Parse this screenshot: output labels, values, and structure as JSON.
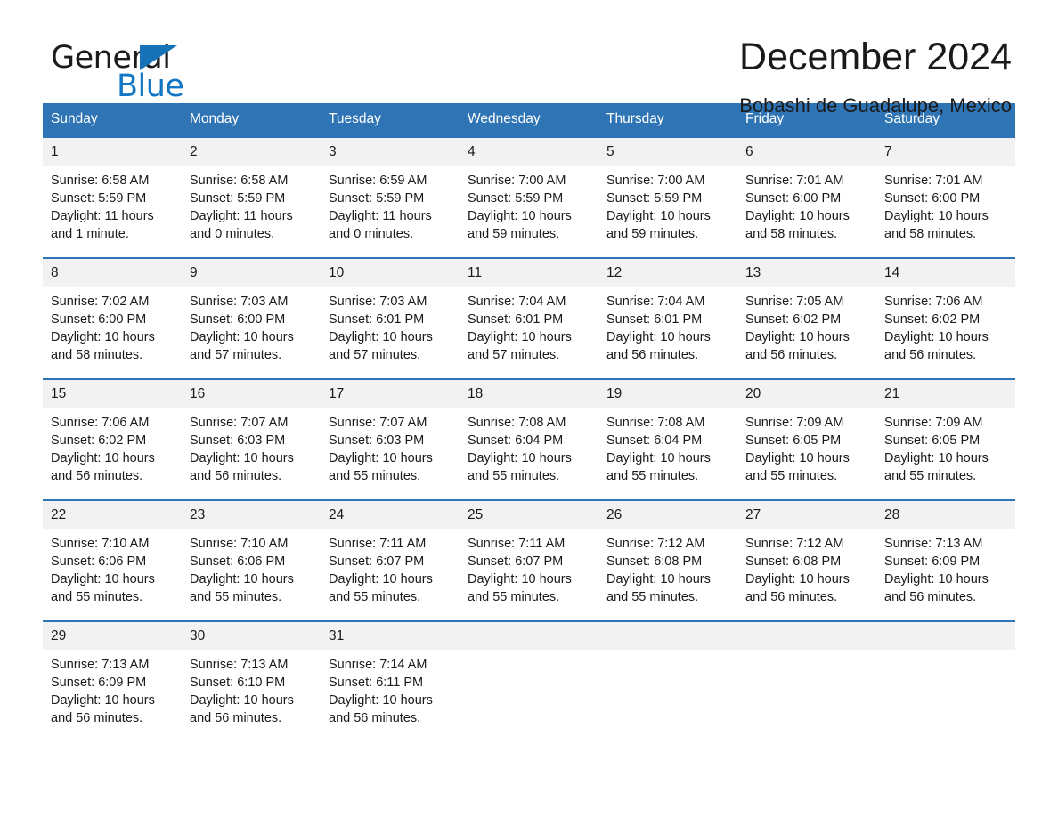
{
  "brand": {
    "word_one": "General",
    "word_two": "Blue",
    "triangle_icon": "blue-triangle-logo-mark",
    "accent_color": "#1177c4"
  },
  "header": {
    "title": "December 2024",
    "subtitle": "Bobashi de Guadalupe, Mexico"
  },
  "theme": {
    "header_row_bg": "#2f74b5",
    "date_band_bg": "#f2f2f2",
    "cell_bg": "#ffffff",
    "text_color": "#1a1a1a"
  },
  "weekdays": [
    "Sunday",
    "Monday",
    "Tuesday",
    "Wednesday",
    "Thursday",
    "Friday",
    "Saturday"
  ],
  "weeks": [
    {
      "dates": [
        "1",
        "2",
        "3",
        "4",
        "5",
        "6",
        "7"
      ],
      "cells": [
        "Sunrise: 6:58 AM\nSunset: 5:59 PM\nDaylight: 11 hours\nand 1 minute.",
        "Sunrise: 6:58 AM\nSunset: 5:59 PM\nDaylight: 11 hours\nand 0 minutes.",
        "Sunrise: 6:59 AM\nSunset: 5:59 PM\nDaylight: 11 hours\nand 0 minutes.",
        "Sunrise: 7:00 AM\nSunset: 5:59 PM\nDaylight: 10 hours\nand 59 minutes.",
        "Sunrise: 7:00 AM\nSunset: 5:59 PM\nDaylight: 10 hours\nand 59 minutes.",
        "Sunrise: 7:01 AM\nSunset: 6:00 PM\nDaylight: 10 hours\nand 58 minutes.",
        "Sunrise: 7:01 AM\nSunset: 6:00 PM\nDaylight: 10 hours\nand 58 minutes."
      ]
    },
    {
      "dates": [
        "8",
        "9",
        "10",
        "11",
        "12",
        "13",
        "14"
      ],
      "cells": [
        "Sunrise: 7:02 AM\nSunset: 6:00 PM\nDaylight: 10 hours\nand 58 minutes.",
        "Sunrise: 7:03 AM\nSunset: 6:00 PM\nDaylight: 10 hours\nand 57 minutes.",
        "Sunrise: 7:03 AM\nSunset: 6:01 PM\nDaylight: 10 hours\nand 57 minutes.",
        "Sunrise: 7:04 AM\nSunset: 6:01 PM\nDaylight: 10 hours\nand 57 minutes.",
        "Sunrise: 7:04 AM\nSunset: 6:01 PM\nDaylight: 10 hours\nand 56 minutes.",
        "Sunrise: 7:05 AM\nSunset: 6:02 PM\nDaylight: 10 hours\nand 56 minutes.",
        "Sunrise: 7:06 AM\nSunset: 6:02 PM\nDaylight: 10 hours\nand 56 minutes."
      ]
    },
    {
      "dates": [
        "15",
        "16",
        "17",
        "18",
        "19",
        "20",
        "21"
      ],
      "cells": [
        "Sunrise: 7:06 AM\nSunset: 6:02 PM\nDaylight: 10 hours\nand 56 minutes.",
        "Sunrise: 7:07 AM\nSunset: 6:03 PM\nDaylight: 10 hours\nand 56 minutes.",
        "Sunrise: 7:07 AM\nSunset: 6:03 PM\nDaylight: 10 hours\nand 55 minutes.",
        "Sunrise: 7:08 AM\nSunset: 6:04 PM\nDaylight: 10 hours\nand 55 minutes.",
        "Sunrise: 7:08 AM\nSunset: 6:04 PM\nDaylight: 10 hours\nand 55 minutes.",
        "Sunrise: 7:09 AM\nSunset: 6:05 PM\nDaylight: 10 hours\nand 55 minutes.",
        "Sunrise: 7:09 AM\nSunset: 6:05 PM\nDaylight: 10 hours\nand 55 minutes."
      ]
    },
    {
      "dates": [
        "22",
        "23",
        "24",
        "25",
        "26",
        "27",
        "28"
      ],
      "cells": [
        "Sunrise: 7:10 AM\nSunset: 6:06 PM\nDaylight: 10 hours\nand 55 minutes.",
        "Sunrise: 7:10 AM\nSunset: 6:06 PM\nDaylight: 10 hours\nand 55 minutes.",
        "Sunrise: 7:11 AM\nSunset: 6:07 PM\nDaylight: 10 hours\nand 55 minutes.",
        "Sunrise: 7:11 AM\nSunset: 6:07 PM\nDaylight: 10 hours\nand 55 minutes.",
        "Sunrise: 7:12 AM\nSunset: 6:08 PM\nDaylight: 10 hours\nand 55 minutes.",
        "Sunrise: 7:12 AM\nSunset: 6:08 PM\nDaylight: 10 hours\nand 56 minutes.",
        "Sunrise: 7:13 AM\nSunset: 6:09 PM\nDaylight: 10 hours\nand 56 minutes."
      ]
    },
    {
      "dates": [
        "29",
        "30",
        "31",
        "",
        "",
        "",
        ""
      ],
      "cells": [
        "Sunrise: 7:13 AM\nSunset: 6:09 PM\nDaylight: 10 hours\nand 56 minutes.",
        "Sunrise: 7:13 AM\nSunset: 6:10 PM\nDaylight: 10 hours\nand 56 minutes.",
        "Sunrise: 7:14 AM\nSunset: 6:11 PM\nDaylight: 10 hours\nand 56 minutes.",
        "",
        "",
        "",
        ""
      ]
    }
  ]
}
